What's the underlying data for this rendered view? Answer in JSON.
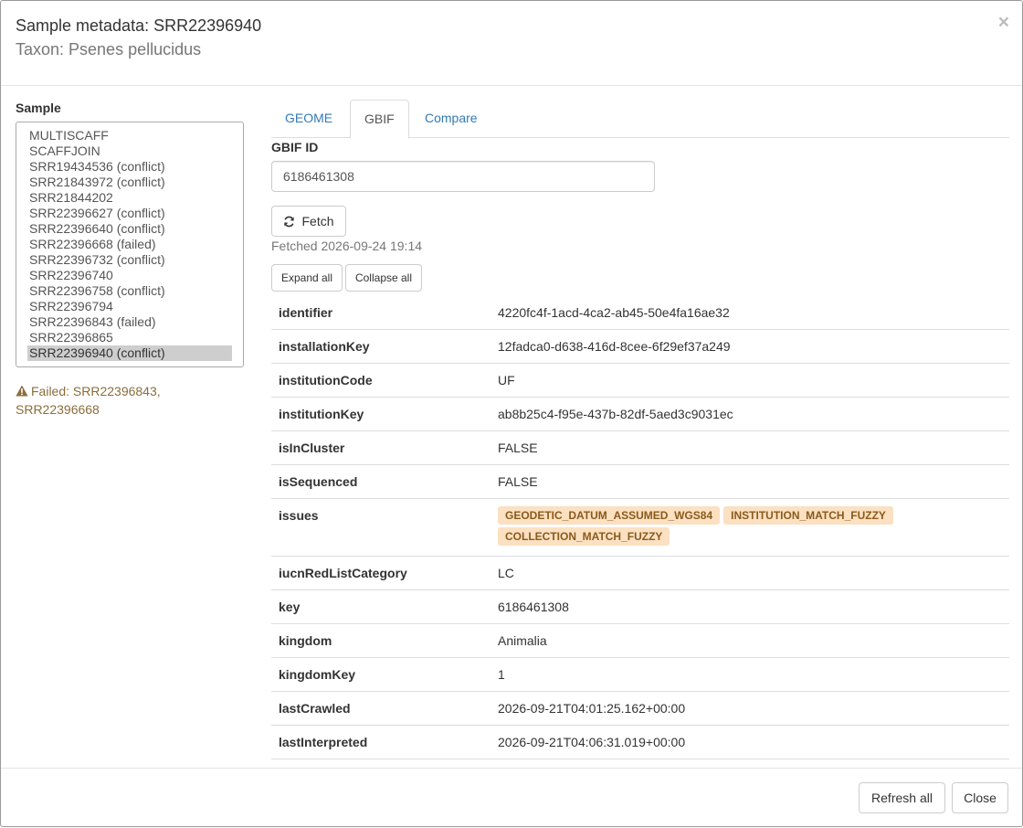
{
  "header": {
    "title": "Sample metadata: SRR22396940",
    "subtitle": "Taxon: Psenes pellucidus",
    "close_symbol": "×"
  },
  "sidebar": {
    "label": "Sample",
    "items": [
      "MULTISCAFF",
      "SCAFFJOIN",
      "SRR19434536 (conflict)",
      "SRR21843972 (conflict)",
      "SRR21844202",
      "SRR22396627 (conflict)",
      "SRR22396640 (conflict)",
      "SRR22396668 (failed)",
      "SRR22396732 (conflict)",
      "SRR22396740",
      "SRR22396758 (conflict)",
      "SRR22396794",
      "SRR22396843 (failed)",
      "SRR22396865",
      "SRR22396940 (conflict)"
    ],
    "selected_item": "SRR22396940 (conflict)",
    "failed_note": "Failed: SRR22396843, SRR22396668",
    "failed_note_icon": "warning-icon"
  },
  "tabs": [
    {
      "label": "GEOME",
      "active": false
    },
    {
      "label": "GBIF",
      "active": true
    },
    {
      "label": "Compare",
      "active": false
    }
  ],
  "gbif": {
    "id_label": "GBIF ID",
    "id_value": "6186461308",
    "fetch_label": "Fetch",
    "fetch_icon": "refresh-icon",
    "fetched_text": "Fetched 2026-09-24 19:14",
    "expand_all_label": "Expand all",
    "collapse_all_label": "Collapse all"
  },
  "records": [
    {
      "key": "identifier",
      "value": "4220fc4f-1acd-4ca2-ab45-50e4fa16ae32"
    },
    {
      "key": "installationKey",
      "value": "12fadca0-d638-416d-8cee-6f29ef37a249"
    },
    {
      "key": "institutionCode",
      "value": "UF"
    },
    {
      "key": "institutionKey",
      "value": "ab8b25c4-f95e-437b-82df-5aed3c9031ec"
    },
    {
      "key": "isInCluster",
      "value": "FALSE"
    },
    {
      "key": "isSequenced",
      "value": "FALSE"
    },
    {
      "key": "issues",
      "badges": [
        "GEODETIC_DATUM_ASSUMED_WGS84",
        "INSTITUTION_MATCH_FUZZY",
        "COLLECTION_MATCH_FUZZY"
      ]
    },
    {
      "key": "iucnRedListCategory",
      "value": "LC"
    },
    {
      "key": "key",
      "value": "6186461308"
    },
    {
      "key": "kingdom",
      "value": "Animalia"
    },
    {
      "key": "kingdomKey",
      "value": "1"
    },
    {
      "key": "lastCrawled",
      "value": "2026-09-21T04:01:25.162+00:00"
    },
    {
      "key": "lastInterpreted",
      "value": "2026-09-21T04:06:31.019+00:00"
    }
  ],
  "footer": {
    "refresh_all_label": "Refresh all",
    "close_label": "Close"
  },
  "colors": {
    "link": "#337ab7",
    "warning_text": "#8a6d3b",
    "badge_bg": "#fbe0c1",
    "selected_bg": "#cecece"
  }
}
